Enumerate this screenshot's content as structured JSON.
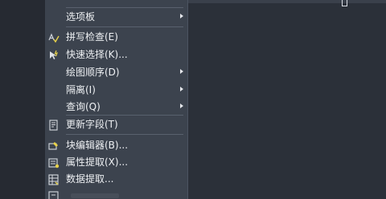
{
  "menu": {
    "items": [
      {
        "label": "",
        "icon": "cropped-icon"
      },
      {
        "label": "选项板",
        "icon": "",
        "submenu": true
      },
      {
        "label": "拼写检查(E)",
        "icon": "spell-check-icon"
      },
      {
        "label": "快速选择(K)...",
        "icon": "quick-select-icon"
      },
      {
        "label": "绘图顺序(D)",
        "icon": "",
        "submenu": true
      },
      {
        "label": "隔离(I)",
        "icon": "",
        "submenu": true
      },
      {
        "label": "查询(Q)",
        "icon": "",
        "submenu": true
      },
      {
        "label": "更新字段(T)",
        "icon": "update-field-icon"
      },
      {
        "label": "块编辑器(B)...",
        "icon": "block-editor-icon"
      },
      {
        "label": "属性提取(X)...",
        "icon": "attribute-extract-icon"
      },
      {
        "label": "数据提取...",
        "icon": "data-extract-icon"
      },
      {
        "label": "",
        "icon": "data-link-icon"
      }
    ]
  },
  "colors": {
    "menu_bg": "#3c434e",
    "canvas_bg": "#2b3039",
    "text": "#eef0f3",
    "separator": "#59616e"
  }
}
